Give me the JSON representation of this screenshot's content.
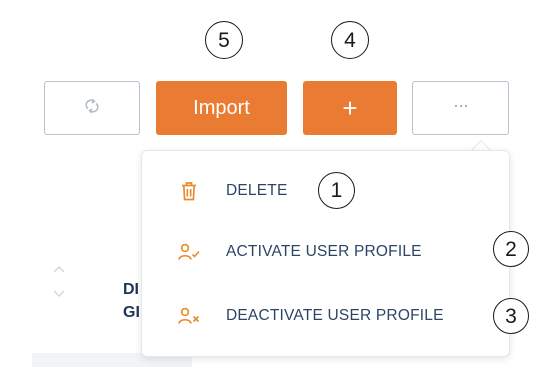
{
  "toolbar": {
    "refresh_icon": "refresh-icon",
    "import_label": "Import",
    "add_label": "+",
    "more_label": "···",
    "accent_color": "#e97b32",
    "outline_color": "#b9c2cf"
  },
  "callouts": {
    "delete": "1",
    "activate": "2",
    "deactivate": "3",
    "add": "4",
    "import": "5"
  },
  "dropdown": {
    "items": [
      {
        "label": "DELETE",
        "icon": "trash-icon"
      },
      {
        "label": "ACTIVATE USER PROFILE",
        "icon": "user-check-icon"
      },
      {
        "label": "DEACTIVATE USER PROFILE",
        "icon": "user-x-icon"
      }
    ]
  },
  "background_table": {
    "header_fragment_line1": "DI",
    "header_fragment_line2": "GI",
    "sort_icon": "sort-icon"
  }
}
